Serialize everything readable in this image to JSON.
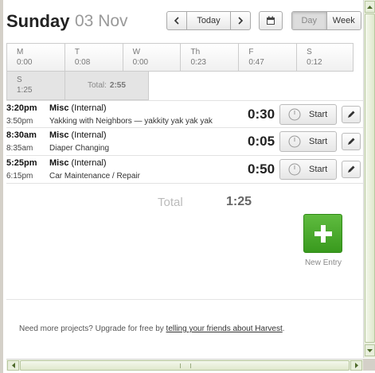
{
  "header": {
    "day_name": "Sunday",
    "date": "03 Nov",
    "prev_icon": "chevron-left-icon",
    "today_label": "Today",
    "next_icon": "chevron-right-icon",
    "calendar_icon": "calendar-icon",
    "view_day_label": "Day",
    "view_week_label": "Week",
    "active_view": "Day"
  },
  "week": {
    "days": [
      {
        "abbr": "M",
        "hours": "0:00"
      },
      {
        "abbr": "T",
        "hours": "0:08"
      },
      {
        "abbr": "W",
        "hours": "0:00"
      },
      {
        "abbr": "Th",
        "hours": "0:23"
      },
      {
        "abbr": "F",
        "hours": "0:47"
      },
      {
        "abbr": "S",
        "hours": "0:12"
      },
      {
        "abbr": "S",
        "hours": "1:25"
      }
    ],
    "total_label": "Total:",
    "total_value": "2:55"
  },
  "entries": [
    {
      "start": "3:20pm",
      "end": "3:50pm",
      "project": "Misc",
      "task": "(Internal)",
      "notes": "Yakking with Neighbors — yakkity yak yak yak",
      "duration": "0:30",
      "start_label": "Start"
    },
    {
      "start": "8:30am",
      "end": "8:35am",
      "project": "Misc",
      "task": "(Internal)",
      "notes": "Diaper Changing",
      "duration": "0:05",
      "start_label": "Start"
    },
    {
      "start": "5:25pm",
      "end": "6:15pm",
      "project": "Misc",
      "task": "(Internal)",
      "notes": "Car Maintenance / Repair",
      "duration": "0:50",
      "start_label": "Start"
    }
  ],
  "totals": {
    "label": "Total",
    "value": "1:25"
  },
  "new_entry": {
    "label": "New Entry",
    "icon": "plus-icon",
    "color": "#4aaa2c"
  },
  "footer": {
    "text": "Need more projects? Upgrade for free by ",
    "link": "telling your friends about Harvest",
    "suffix": "."
  }
}
